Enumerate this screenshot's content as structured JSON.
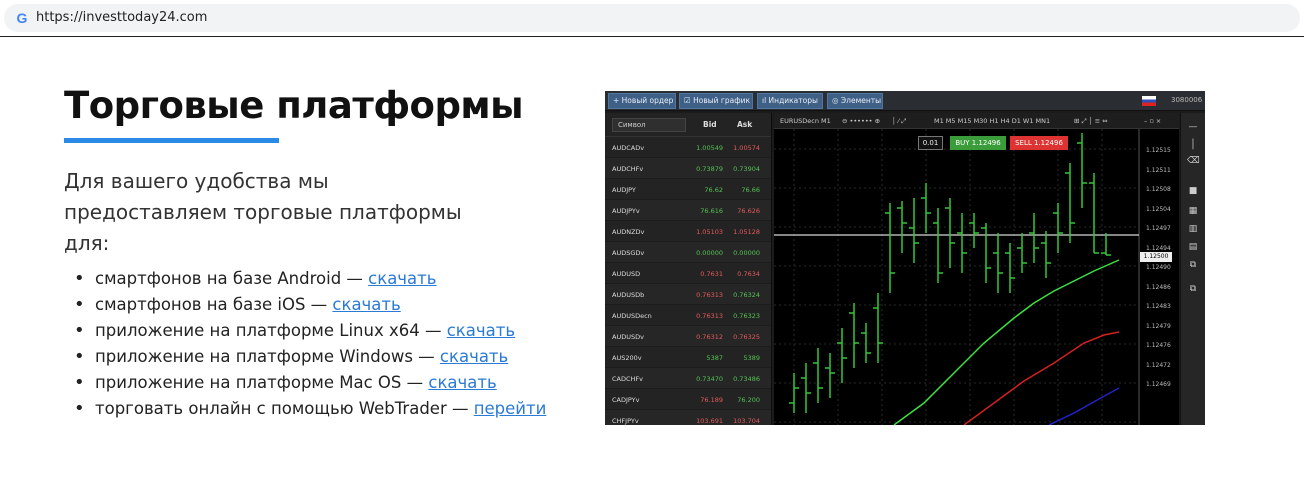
{
  "browser": {
    "url": "https://investtoday24.com",
    "favicon": "G"
  },
  "article": {
    "title": "Торговые платформы",
    "intro": "Для вашего удобства мы предоставляем торговые платформы для:",
    "items": [
      {
        "text": "смартфонов на базе Android — ",
        "link": "скачать"
      },
      {
        "text": "смартфонов на базе iOS — ",
        "link": "скачать"
      },
      {
        "text": "приложение на платформе Linux x64 — ",
        "link": "скачать"
      },
      {
        "text": "приложение на платформе Windows — ",
        "link": "скачать"
      },
      {
        "text": "приложение на платформе Mac OS — ",
        "link": "скачать"
      },
      {
        "text": "торговать онлайн с помощью WebTrader — ",
        "link": "перейти"
      }
    ],
    "accent_color": "#2a8ae6"
  },
  "platform": {
    "toolbar": {
      "new_order": "+ Новый ордер",
      "new_chart": "☑ Новый график",
      "indicators": "ıl Индикаторы",
      "elements": "◎ Элементы",
      "account": "3080006"
    },
    "watchlist": {
      "symbol_header": "Символ",
      "bid_header": "Bid",
      "ask_header": "Ask",
      "rows": [
        {
          "symbol": "AUDCADv",
          "bid": "1.00549",
          "ask": "1.00574",
          "bid_dir": "up",
          "ask_dir": "dn"
        },
        {
          "symbol": "AUDCHFv",
          "bid": "0.73879",
          "ask": "0.73904",
          "bid_dir": "up",
          "ask_dir": "up"
        },
        {
          "symbol": "AUDJPY",
          "bid": "76.62",
          "ask": "76.66",
          "bid_dir": "up",
          "ask_dir": "up"
        },
        {
          "symbol": "AUDJPYv",
          "bid": "76.616",
          "ask": "76.626",
          "bid_dir": "up",
          "ask_dir": "dn"
        },
        {
          "symbol": "AUDNZDv",
          "bid": "1.05103",
          "ask": "1.05128",
          "bid_dir": "dn",
          "ask_dir": "dn"
        },
        {
          "symbol": "AUDSGDv",
          "bid": "0.00000",
          "ask": "0.00000",
          "bid_dir": "up",
          "ask_dir": "up"
        },
        {
          "symbol": "AUDUSD",
          "bid": "0.7631",
          "ask": "0.7634",
          "bid_dir": "dn",
          "ask_dir": "dn"
        },
        {
          "symbol": "AUDUSDb",
          "bid": "0.76313",
          "ask": "0.76324",
          "bid_dir": "dn",
          "ask_dir": "up"
        },
        {
          "symbol": "AUDUSDecn",
          "bid": "0.76313",
          "ask": "0.76323",
          "bid_dir": "dn",
          "ask_dir": "up"
        },
        {
          "symbol": "AUDUSDv",
          "bid": "0.76312",
          "ask": "0.76325",
          "bid_dir": "dn",
          "ask_dir": "dn"
        },
        {
          "symbol": "AUS200v",
          "bid": "5387",
          "ask": "5389",
          "bid_dir": "up",
          "ask_dir": "up"
        },
        {
          "symbol": "CADCHFv",
          "bid": "0.73470",
          "ask": "0.73486",
          "bid_dir": "up",
          "ask_dir": "up"
        },
        {
          "symbol": "CADJPYv",
          "bid": "76.189",
          "ask": "76.200",
          "bid_dir": "dn",
          "ask_dir": "up"
        },
        {
          "symbol": "CHFJPYv",
          "bid": "103.691",
          "ask": "103.704",
          "bid_dir": "dn",
          "ask_dir": "dn"
        }
      ]
    },
    "chart": {
      "symbol": "EURUSDecn M1",
      "timeframes": "M1 M5 M15 M30 H1 H4 D1 W1 MN1",
      "lot": "0.01",
      "buy": "BUY 1.12496",
      "sell": "SELL 1.12496",
      "current_price": "1.12500",
      "price_ticks": [
        "1.12515",
        "1.12511",
        "1.12508",
        "1.12504",
        "1.12497",
        "1.12494",
        "1.12490",
        "1.12486",
        "1.12483",
        "1.12479",
        "1.12476",
        "1.12472",
        "1.12469"
      ],
      "colors": {
        "bars": "#34c734",
        "ma_fast": "#3ee03e",
        "ma_mid": "#d42020",
        "ma_slow": "#2222cc"
      }
    }
  }
}
